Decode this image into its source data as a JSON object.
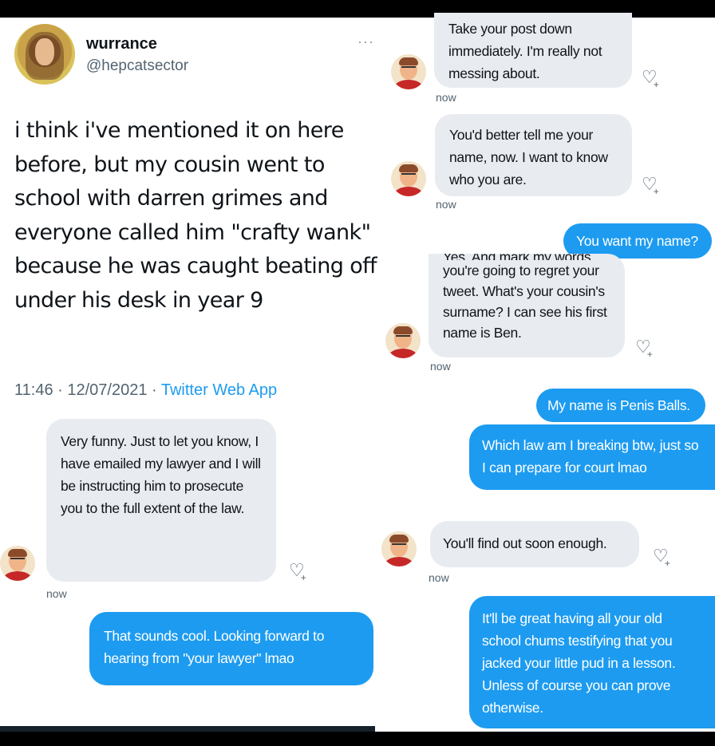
{
  "tweet": {
    "display_name": "wurrance",
    "handle": "@hepcatsector",
    "more_icon": "···",
    "text": "i think i've mentioned it on here before, but my cousin went to school with darren grimes and everyone called him \"crafty wank\" because he was caught beating off under his desk in year 9",
    "timestamp": "11:46 · 12/07/2021 · ",
    "source": "Twitter Web App"
  },
  "dm_left": {
    "msg1": "Very funny. Just to let you know, I have emailed my lawyer and I will be instructing him to prosecute you to the full extent of the law.",
    "msg1_time": "now",
    "msg2": "That sounds cool. Looking forward to hearing from \"your lawyer\" lmao"
  },
  "dm_right": {
    "msg1": "Take your post down immediately. I'm really not messing about.",
    "msg1_time": "now",
    "msg2": "You'd better tell me your name, now. I want to know who you are.",
    "msg2_time": "now",
    "msg3": "You want my name?",
    "msg4_clipped": "Yes. And mark my words,",
    "msg4": "you're going to regret your tweet. What's your cousin's surname? I can see his first name is Ben.",
    "msg4_time": "now",
    "msg5": "My name is Penis Balls.",
    "msg6": "Which law am I breaking btw, just so I can prepare for court lmao",
    "msg7": "You'll find out soon enough.",
    "msg7_time": "now",
    "msg8": "It'll be great having all your old school chums testifying that you jacked your little pud in a lesson. Unless of course you can prove otherwise."
  },
  "colors": {
    "incoming_bubble": "#e8ebf0",
    "outgoing_bubble": "#1d9bf0",
    "link": "#1d9bf0",
    "muted_text": "#536471"
  },
  "icons": {
    "heart": "♡",
    "plus": "+"
  }
}
